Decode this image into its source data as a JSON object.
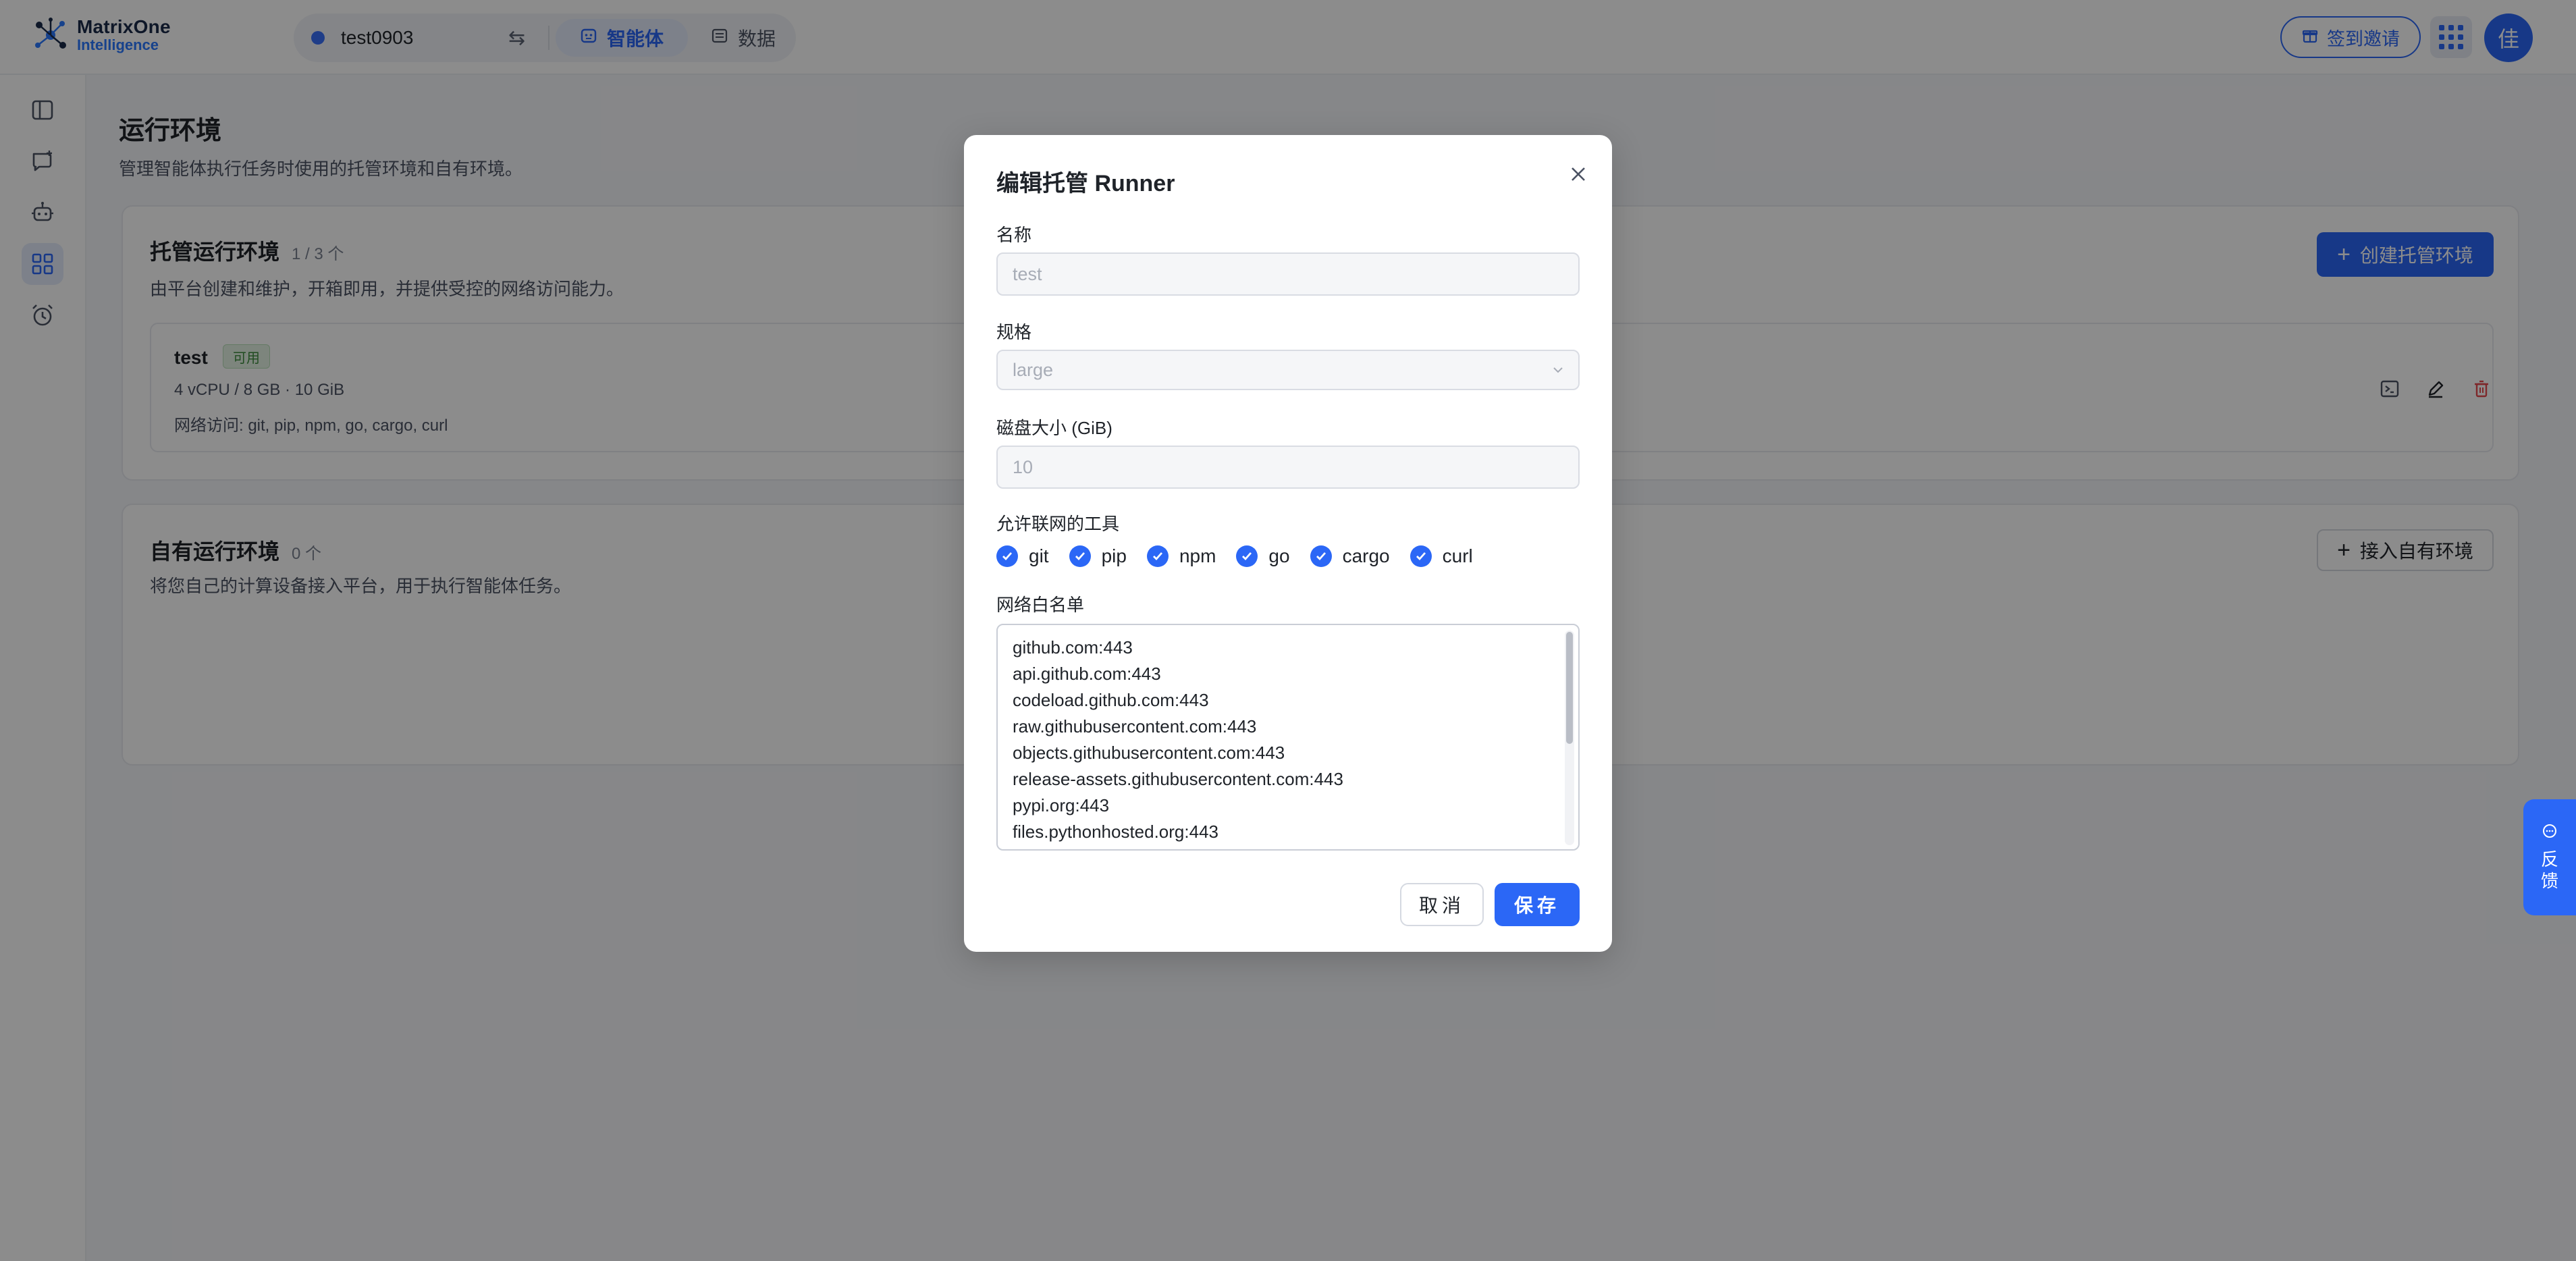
{
  "brand": {
    "line1": "MatrixOne",
    "line2": "Intelligence"
  },
  "header": {
    "workspace_name": "test0903",
    "tabs": [
      {
        "label": "智能体",
        "active": true
      },
      {
        "label": "数据",
        "active": false
      }
    ],
    "invite_label": "签到邀请",
    "avatar_text": "佳"
  },
  "sidebar": {
    "items": [
      {
        "icon": "sidebar-panel-icon",
        "active": false
      },
      {
        "icon": "new-chat-icon",
        "active": false
      },
      {
        "icon": "agent-robot-icon",
        "active": false
      },
      {
        "icon": "dashboard-grid-icon",
        "active": true
      },
      {
        "icon": "alarm-clock-icon",
        "active": false
      }
    ]
  },
  "page": {
    "title": "运行环境",
    "description": "管理智能体执行任务时使用的托管环境和自有环境。"
  },
  "managed": {
    "title": "托管运行环境",
    "count": "1 / 3 个",
    "description": "由平台创建和维护，开箱即用，并提供受控的网络访问能力。",
    "create_button": "创建托管环境",
    "runners": [
      {
        "name": "test",
        "status": "可用",
        "spec": "4 vCPU / 8 GB · 10 GiB",
        "network": "网络访问: git, pip, npm, go, cargo, curl"
      }
    ]
  },
  "own": {
    "title": "自有运行环境",
    "count": "0 个",
    "description": "将您自己的计算设备接入平台，用于执行智能体任务。",
    "connect_button": "接入自有环境"
  },
  "feedback": {
    "line1": "反",
    "line2": "馈"
  },
  "modal": {
    "title": "编辑托管 Runner",
    "name_label": "名称",
    "name_value": "test",
    "spec_label": "规格",
    "spec_value": "large",
    "disk_label": "磁盘大小 (GiB)",
    "disk_value": "10",
    "tools_label": "允许联网的工具",
    "tools": [
      {
        "label": "git",
        "checked": true
      },
      {
        "label": "pip",
        "checked": true
      },
      {
        "label": "npm",
        "checked": true
      },
      {
        "label": "go",
        "checked": true
      },
      {
        "label": "cargo",
        "checked": true
      },
      {
        "label": "curl",
        "checked": true
      }
    ],
    "whitelist_label": "网络白名单",
    "whitelist": [
      "github.com:443",
      "api.github.com:443",
      "codeload.github.com:443",
      "raw.githubusercontent.com:443",
      "objects.githubusercontent.com:443",
      "release-assets.githubusercontent.com:443",
      "pypi.org:443",
      "files.pythonhosted.org:443"
    ],
    "cancel_label": "取消",
    "save_label": "保存"
  },
  "colors": {
    "accent": "#2b67f6",
    "badge_green": "#3b8a3b",
    "danger": "#e5484d"
  }
}
